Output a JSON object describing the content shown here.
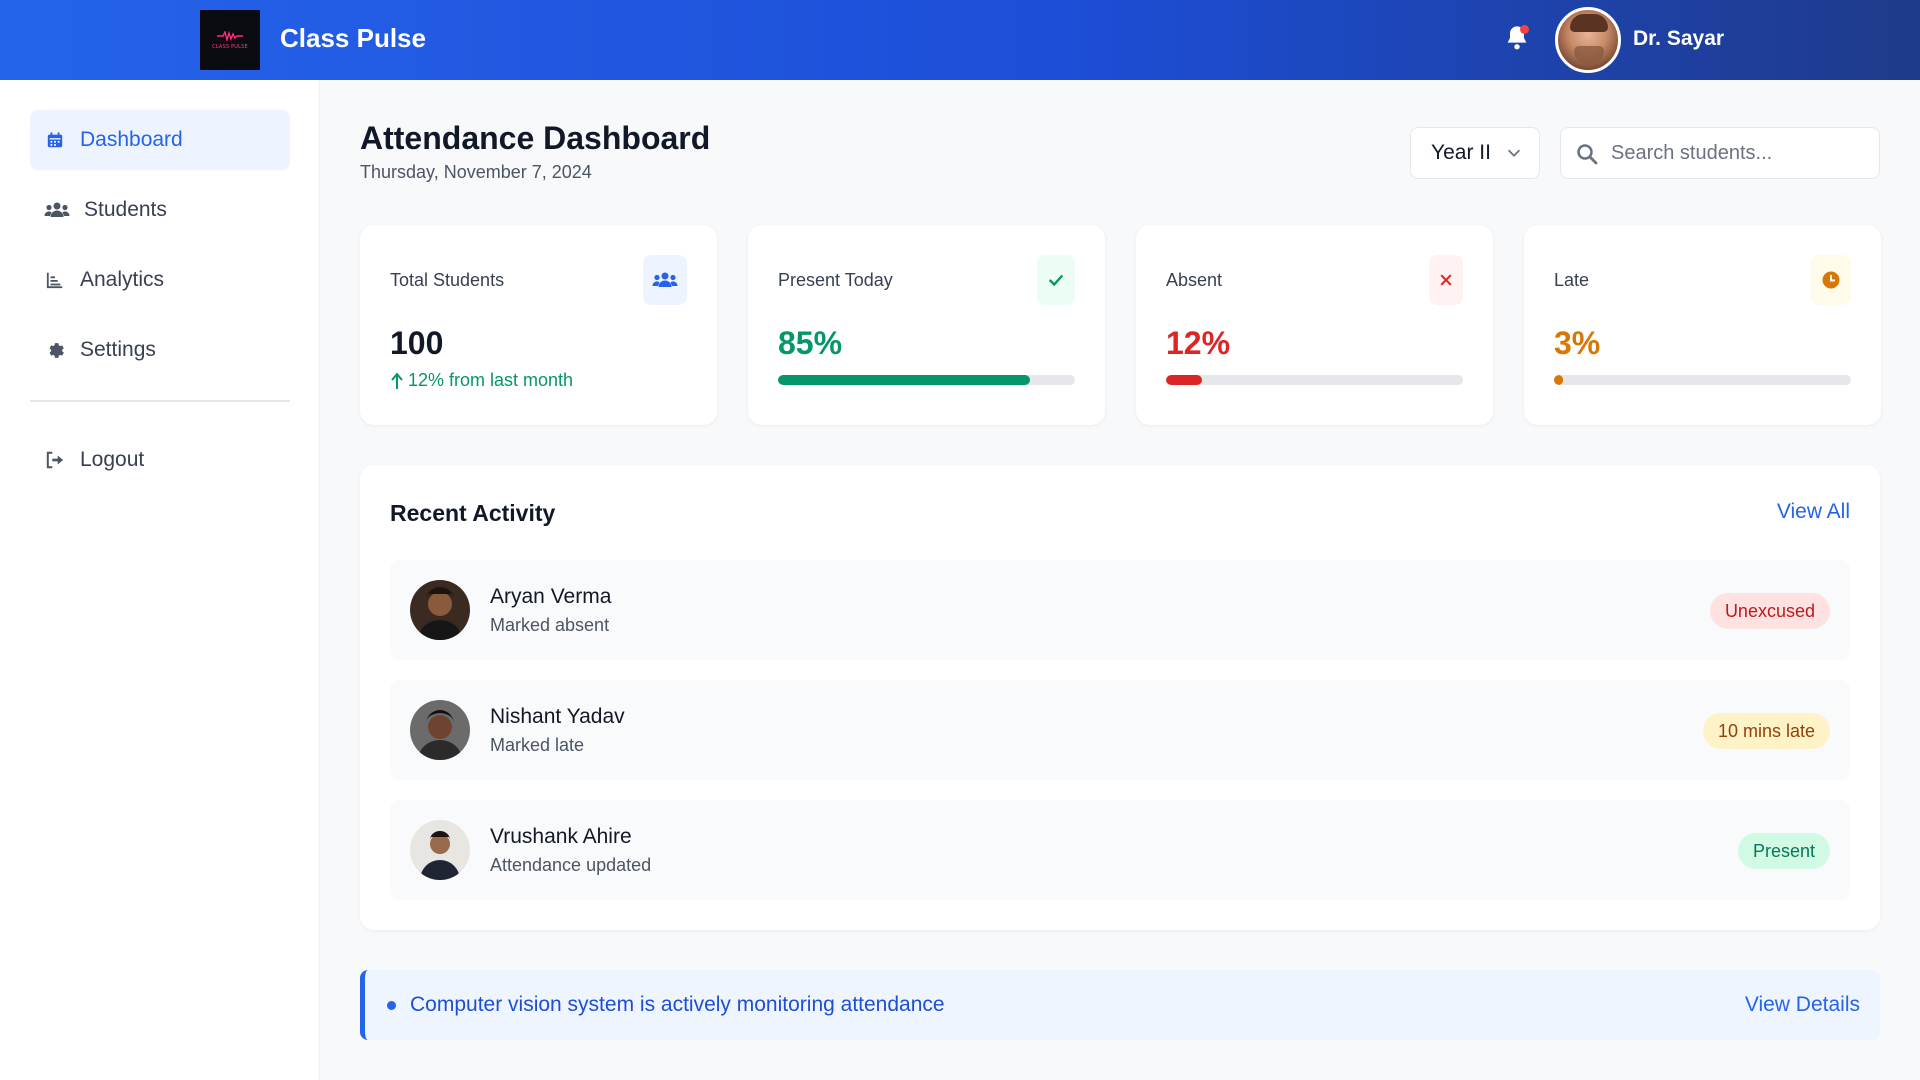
{
  "header": {
    "brand": "Class Pulse",
    "logo_text": "CLASS PULSE",
    "user_name": "Dr. Sayar",
    "notification_icon": "bell-icon",
    "has_unread": true
  },
  "sidebar": {
    "items": [
      {
        "label": "Dashboard",
        "icon": "calendar-icon",
        "active": true
      },
      {
        "label": "Students",
        "icon": "users-icon",
        "active": false
      },
      {
        "label": "Analytics",
        "icon": "chart-icon",
        "active": false
      },
      {
        "label": "Settings",
        "icon": "gear-icon",
        "active": false
      }
    ],
    "logout": {
      "label": "Logout",
      "icon": "logout-icon"
    }
  },
  "page": {
    "title": "Attendance Dashboard",
    "date": "Thursday, November 7, 2024"
  },
  "filters": {
    "year_selected": "Year II",
    "search_placeholder": "Search students..."
  },
  "stats": [
    {
      "label": "Total Students",
      "value": "100",
      "trend": "12% from last month",
      "icon": "users-icon",
      "color": "#111827",
      "icon_color": "#2563eb",
      "icon_bg": "#eef4ff"
    },
    {
      "label": "Present Today",
      "value": "85%",
      "progress": 0.85,
      "icon": "check-icon",
      "color": "#059669",
      "icon_color": "#059669",
      "icon_bg": "#ecfdf5"
    },
    {
      "label": "Absent",
      "value": "12%",
      "progress": 0.12,
      "icon": "x-icon",
      "color": "#dc2626",
      "icon_color": "#dc2626",
      "icon_bg": "#fef2f2"
    },
    {
      "label": "Late",
      "value": "3%",
      "progress": 0.03,
      "icon": "clock-icon",
      "color": "#d97706",
      "icon_color": "#d97706",
      "icon_bg": "#fffbeb"
    }
  ],
  "activity": {
    "title": "Recent Activity",
    "view_all": "View All",
    "items": [
      {
        "name": "Aryan Verma",
        "action": "Marked absent",
        "status": "Unexcused",
        "status_fg": "#b91c1c",
        "status_bg": "#fee2e2"
      },
      {
        "name": "Nishant Yadav",
        "action": "Marked late",
        "status": "10 mins late",
        "status_fg": "#92400e",
        "status_bg": "#fef3c7"
      },
      {
        "name": "Vrushank Ahire",
        "action": "Attendance updated",
        "status": "Present",
        "status_fg": "#047857",
        "status_bg": "#d1fae5"
      }
    ]
  },
  "notice": {
    "message": "Computer vision system is actively monitoring attendance",
    "action": "View Details"
  }
}
